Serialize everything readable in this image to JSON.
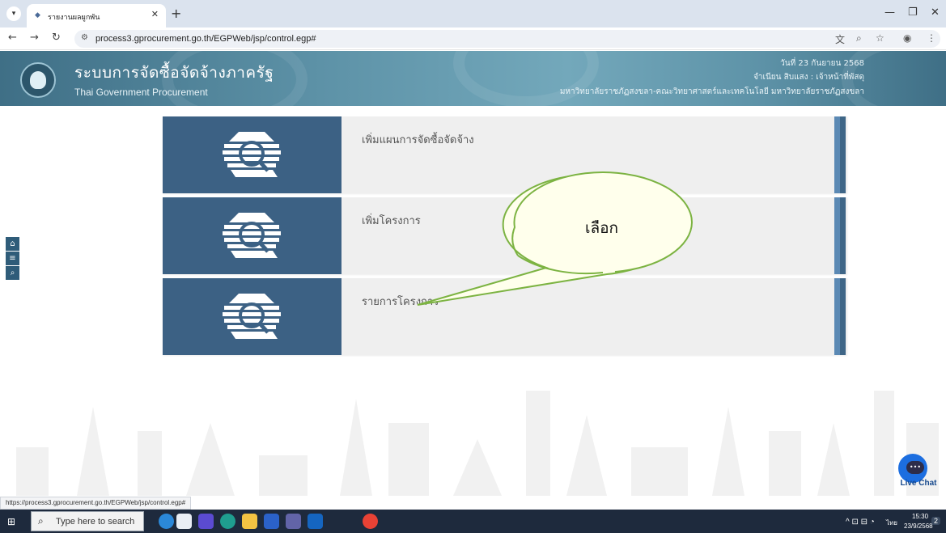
{
  "browser": {
    "tab_title": "รายงานผลผูกพัน",
    "new_tab_label": "+",
    "url": "process3.gprocurement.go.th/EGPWeb/jsp/control.egp#",
    "status_url": "https://process3.gprocurement.go.th/EGPWeb/jsp/control.egp#"
  },
  "header": {
    "title": "ระบบการจัดซื้อจัดจ้างภาครัฐ",
    "subtitle": "Thai Government Procurement",
    "date": "วันที่ 23 กันยายน 2568",
    "user": "จำเนียน สิบแสง : เจ้าหน้าที่พัสดุ",
    "organization": "มหาวิทยาลัยราชภัฏสงขลา-คณะวิทยาศาสตร์และเทคโนโลยี มหาวิทยาลัยราชภัฏสงขลา"
  },
  "menu": {
    "items": [
      {
        "label": "เพิ่มแผนการจัดซื้อจัดจ้าง"
      },
      {
        "label": "เพิ่มโครงการ"
      },
      {
        "label": "รายการโครงการ"
      }
    ]
  },
  "annotation": {
    "callout_text": "เลือก"
  },
  "live_chat": {
    "label": "Live Chat"
  },
  "taskbar": {
    "search_placeholder": "Type here to search",
    "language": "ไทย",
    "time": "15:30",
    "date": "23/9/2568",
    "notification_count": "2"
  },
  "colors": {
    "header_teal": "#5e93a8",
    "card_icon_panel": "#3c6184",
    "card_background": "#efefef",
    "callout_stroke": "#7cb342",
    "live_chat_blue": "#1c6ee0"
  },
  "icons": [
    "home-icon",
    "menu-icon",
    "search-icon",
    "procurement-emblem-icon",
    "live-chat-icon"
  ]
}
